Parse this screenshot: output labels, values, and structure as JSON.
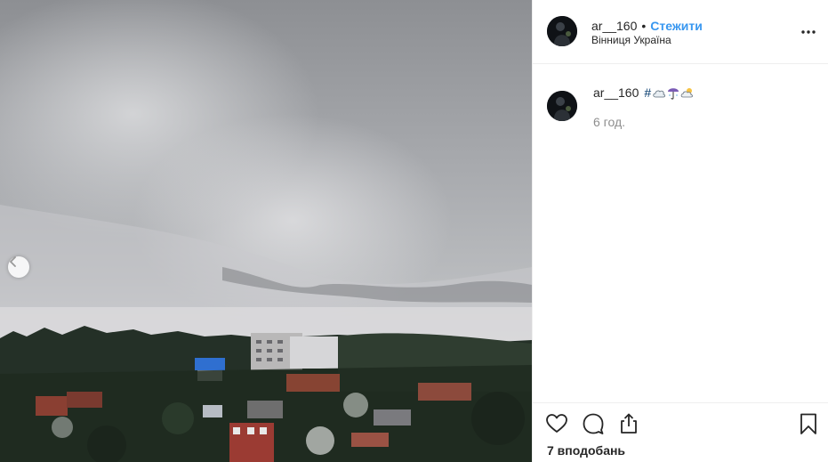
{
  "post": {
    "username": "ar__160",
    "separator": "•",
    "follow_label": "Стежити",
    "location": "Вінниця Україна",
    "caption_username": "ar__160",
    "hashtag_prefix": "#",
    "caption_emojis": [
      "cloud-emoji",
      "umbrella-emoji",
      "sun-behind-cloud-emoji"
    ],
    "time_ago": "6 год.",
    "likes_label": "7 вподобань"
  },
  "icons": {
    "more": "more-options-icon",
    "prev": "chevron-left-icon",
    "like": "heart-icon",
    "comment": "comment-icon",
    "share": "share-icon",
    "save": "bookmark-icon"
  },
  "colors": {
    "follow": "#3897f0",
    "text": "#262626",
    "muted": "#8e8e8e",
    "border": "#efefef"
  }
}
